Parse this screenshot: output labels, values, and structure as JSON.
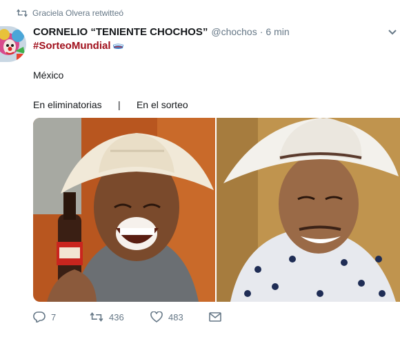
{
  "retweet_context": {
    "text": "Graciela Olvera retwitteó",
    "icon": "retweet-icon"
  },
  "author": {
    "display_name": "CORNELIO “TENIENTE CHOCHOS”",
    "handle": "@chochos",
    "separator": "·",
    "timestamp": "6 min"
  },
  "tweet": {
    "hashtag": "#SorteoMundial",
    "text_line1": "México",
    "text_line2_left": "En eliminatorias",
    "text_line2_sep": "|",
    "text_line2_right": "En el sorteo"
  },
  "actions": {
    "reply_count": "7",
    "retweet_count": "436",
    "like_count": "483"
  },
  "colors": {
    "hashtag": "#a00f1b",
    "muted_text": "#657786",
    "main_text": "#14171a"
  }
}
